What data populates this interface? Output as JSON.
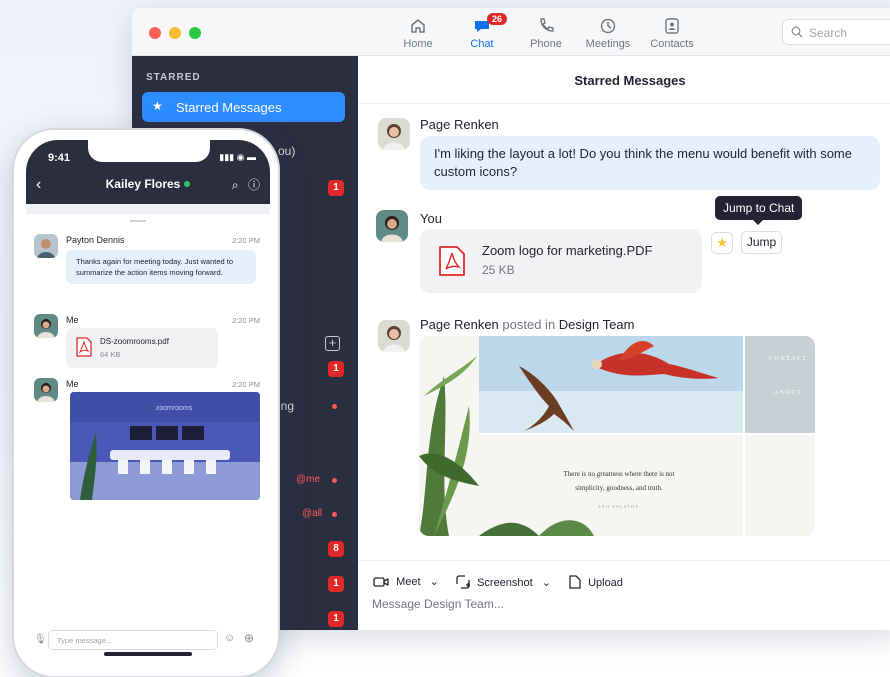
{
  "nav": {
    "items": [
      {
        "label": "Home",
        "icon": "home-icon"
      },
      {
        "label": "Chat",
        "icon": "chat-icon",
        "badge": "26"
      },
      {
        "label": "Phone",
        "icon": "phone-icon"
      },
      {
        "label": "Meetings",
        "icon": "clock-icon"
      },
      {
        "label": "Contacts",
        "icon": "contacts-icon"
      }
    ],
    "search_placeholder": "Search"
  },
  "sidebar": {
    "header": "STARRED",
    "selected": "Starred Messages",
    "partial_label_1": "ou)",
    "partial_label_2": "ing",
    "badges": [
      "1",
      "1",
      "8",
      "1",
      "1"
    ],
    "mention_me": "@me",
    "mention_all": "@all"
  },
  "main": {
    "title": "Starred Messages",
    "messages": [
      {
        "sender": "Page Renken",
        "text": "I'm liking the layout a lot! Do you think the menu would benefit with some custom icons?"
      },
      {
        "sender": "You",
        "file_name": "Zoom logo for marketing.PDF",
        "file_size": "25 KB"
      },
      {
        "sender": "Page Renken",
        "posted_in": "posted in",
        "channel": "Design Team"
      }
    ],
    "tooltip": "Jump to Chat",
    "jump_label": "Jump",
    "image_card": {
      "nav_contact": "CONTACT",
      "nav_about": "ABOUT",
      "quote_line1": "There is no greatness where there is not",
      "quote_line2": "simplicity, goodness, and truth.",
      "quote_author": "LEO TOLSTOY"
    },
    "composer": {
      "meet": "Meet",
      "screenshot": "Screenshot",
      "upload": "Upload",
      "placeholder": "Message Design Team..."
    }
  },
  "phone": {
    "time": "9:41",
    "contact": "Kailey Flores",
    "messages": [
      {
        "sender": "Payton Dennis",
        "time": "2:20 PM",
        "text": "Thanks again for meeting today. Just wanted to summarize the action items moving forward."
      },
      {
        "sender": "Me",
        "time": "2:20 PM",
        "file_name": "DS-zoomrooms.pdf",
        "file_size": "64 KB"
      },
      {
        "sender": "Me",
        "time": "2:20 PM",
        "photo_caption": "zoomrooms"
      }
    ],
    "input_placeholder": "Type message..."
  },
  "colors": {
    "accent": "#2d8cff",
    "sidebar": "#2b2e3f",
    "badge": "#e02828",
    "bubble": "#e6f0fb"
  }
}
